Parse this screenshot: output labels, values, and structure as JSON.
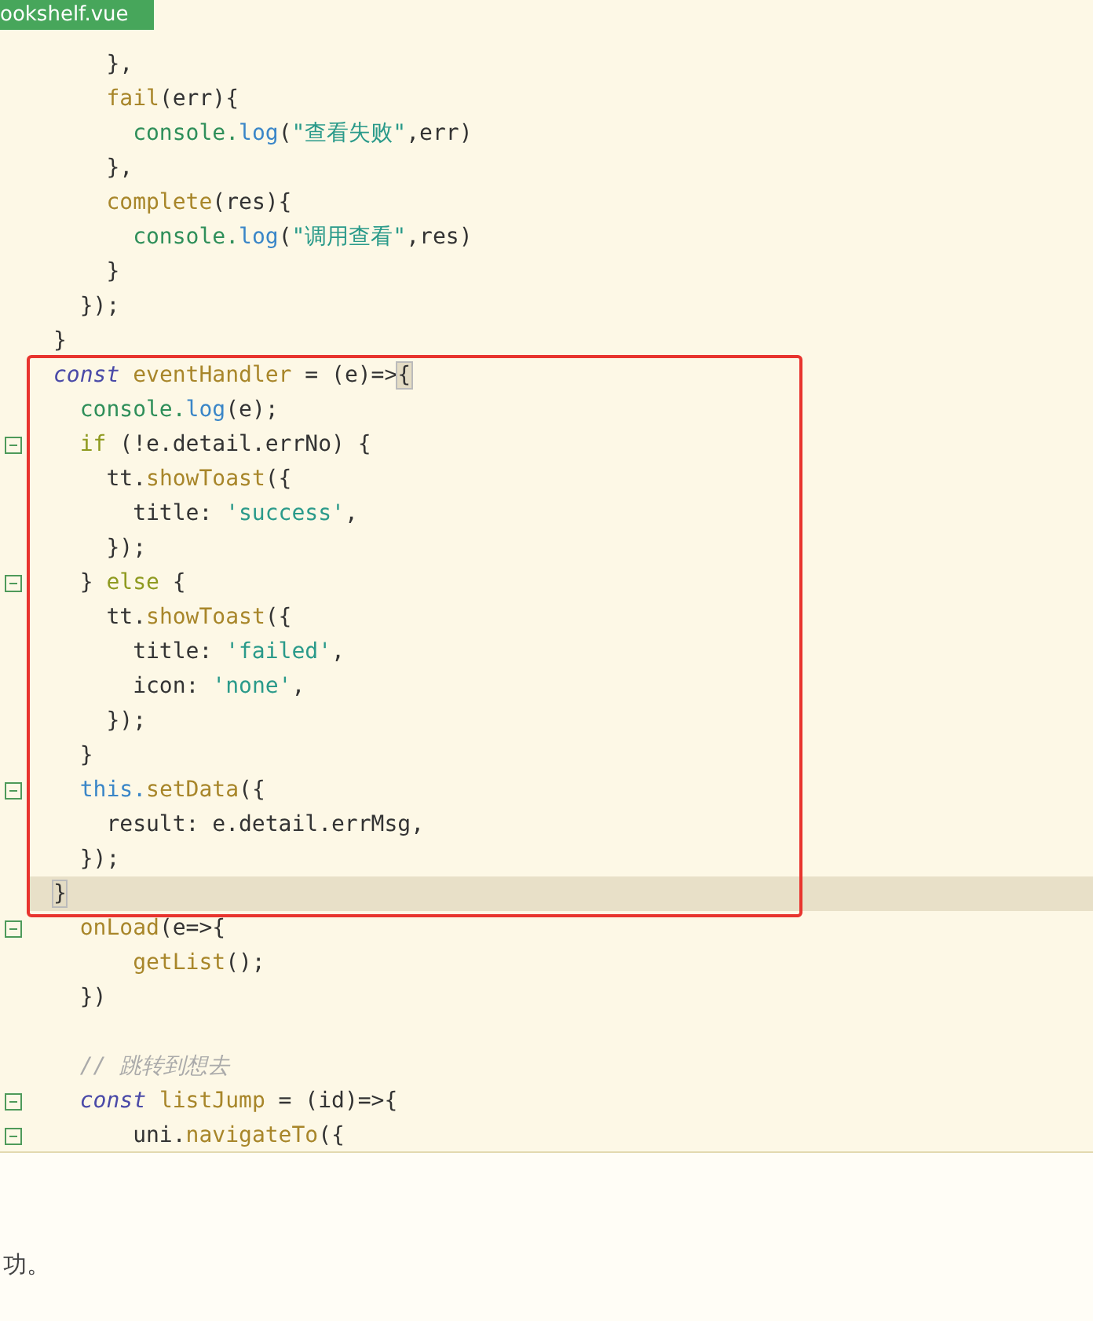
{
  "tab": {
    "title": "ookshelf.vue",
    "selected": true
  },
  "editor": {
    "blocks": [
      {
        "boxed": false,
        "lines": [
          {
            "fold": false,
            "current": false,
            "tokens": [
              {
                "text": "    },",
                "kind": "plain"
              }
            ]
          },
          {
            "fold": false,
            "current": false,
            "tokens": [
              {
                "text": "    fail",
                "kind": "func"
              },
              {
                "text": "(err){",
                "kind": "plain"
              }
            ]
          },
          {
            "fold": false,
            "current": false,
            "tokens": [
              {
                "text": "      console.",
                "kind": "obj"
              },
              {
                "text": "log",
                "kind": "method"
              },
              {
                "text": "(",
                "kind": "plain"
              },
              {
                "text": "\"查看失败\"",
                "kind": "string"
              },
              {
                "text": ",err)",
                "kind": "plain"
              }
            ]
          },
          {
            "fold": false,
            "current": false,
            "tokens": [
              {
                "text": "    },",
                "kind": "plain"
              }
            ]
          },
          {
            "fold": false,
            "current": false,
            "tokens": [
              {
                "text": "    complete",
                "kind": "func"
              },
              {
                "text": "(res){",
                "kind": "plain"
              }
            ]
          },
          {
            "fold": false,
            "current": false,
            "tokens": [
              {
                "text": "      console.",
                "kind": "obj"
              },
              {
                "text": "log",
                "kind": "method"
              },
              {
                "text": "(",
                "kind": "plain"
              },
              {
                "text": "\"调用查看\"",
                "kind": "string"
              },
              {
                "text": ",res)",
                "kind": "plain"
              }
            ]
          },
          {
            "fold": false,
            "current": false,
            "tokens": [
              {
                "text": "    }",
                "kind": "plain"
              }
            ]
          },
          {
            "fold": false,
            "current": false,
            "tokens": [
              {
                "text": "  });",
                "kind": "plain"
              }
            ]
          },
          {
            "fold": false,
            "current": false,
            "tokens": [
              {
                "text": "}",
                "kind": "plain"
              }
            ]
          }
        ]
      },
      {
        "boxed": true,
        "lines": [
          {
            "fold": false,
            "current": false,
            "tokens": [
              {
                "text": "const",
                "kind": "keyword"
              },
              {
                "text": " eventHandler",
                "kind": "func"
              },
              {
                "text": " = (e)=>",
                "kind": "plain"
              },
              {
                "text": "{",
                "kind": "match"
              }
            ]
          },
          {
            "fold": false,
            "current": false,
            "tokens": [
              {
                "text": "  console.",
                "kind": "obj"
              },
              {
                "text": "log",
                "kind": "method"
              },
              {
                "text": "(e);",
                "kind": "plain"
              }
            ]
          },
          {
            "fold": true,
            "current": false,
            "tokens": [
              {
                "text": "  if",
                "kind": "control"
              },
              {
                "text": " (!e.detail.errNo) {",
                "kind": "plain"
              }
            ]
          },
          {
            "fold": false,
            "current": false,
            "tokens": [
              {
                "text": "    tt.",
                "kind": "plain"
              },
              {
                "text": "showToast",
                "kind": "func"
              },
              {
                "text": "({",
                "kind": "plain"
              }
            ]
          },
          {
            "fold": false,
            "current": false,
            "tokens": [
              {
                "text": "      title: ",
                "kind": "plain"
              },
              {
                "text": "'success'",
                "kind": "string"
              },
              {
                "text": ",",
                "kind": "plain"
              }
            ]
          },
          {
            "fold": false,
            "current": false,
            "tokens": [
              {
                "text": "    });",
                "kind": "plain"
              }
            ]
          },
          {
            "fold": true,
            "current": false,
            "tokens": [
              {
                "text": "  } ",
                "kind": "plain"
              },
              {
                "text": "else",
                "kind": "control"
              },
              {
                "text": " {",
                "kind": "plain"
              }
            ]
          },
          {
            "fold": false,
            "current": false,
            "tokens": [
              {
                "text": "    tt.",
                "kind": "plain"
              },
              {
                "text": "showToast",
                "kind": "func"
              },
              {
                "text": "({",
                "kind": "plain"
              }
            ]
          },
          {
            "fold": false,
            "current": false,
            "tokens": [
              {
                "text": "      title: ",
                "kind": "plain"
              },
              {
                "text": "'failed'",
                "kind": "string"
              },
              {
                "text": ",",
                "kind": "plain"
              }
            ]
          },
          {
            "fold": false,
            "current": false,
            "tokens": [
              {
                "text": "      icon: ",
                "kind": "plain"
              },
              {
                "text": "'none'",
                "kind": "string"
              },
              {
                "text": ",",
                "kind": "plain"
              }
            ]
          },
          {
            "fold": false,
            "current": false,
            "tokens": [
              {
                "text": "    });",
                "kind": "plain"
              }
            ]
          },
          {
            "fold": false,
            "current": false,
            "tokens": [
              {
                "text": "  }",
                "kind": "plain"
              }
            ]
          },
          {
            "fold": true,
            "current": false,
            "tokens": [
              {
                "text": "  this.",
                "kind": "method"
              },
              {
                "text": "setData",
                "kind": "func"
              },
              {
                "text": "({",
                "kind": "plain"
              }
            ]
          },
          {
            "fold": false,
            "current": false,
            "tokens": [
              {
                "text": "    result: e.detail.errMsg,",
                "kind": "plain"
              }
            ]
          },
          {
            "fold": false,
            "current": false,
            "tokens": [
              {
                "text": "  });",
                "kind": "plain"
              }
            ]
          },
          {
            "fold": false,
            "current": true,
            "tokens": [
              {
                "text": "}",
                "kind": "match"
              }
            ]
          }
        ]
      },
      {
        "boxed": false,
        "lines": [
          {
            "fold": true,
            "current": false,
            "tokens": [
              {
                "text": "  onLoad",
                "kind": "func"
              },
              {
                "text": "(e=>{",
                "kind": "plain"
              }
            ]
          },
          {
            "fold": false,
            "current": false,
            "tokens": [
              {
                "text": "      getList",
                "kind": "func"
              },
              {
                "text": "();",
                "kind": "plain"
              }
            ]
          },
          {
            "fold": false,
            "current": false,
            "tokens": [
              {
                "text": "  })",
                "kind": "plain"
              }
            ]
          },
          {
            "fold": false,
            "current": false
          },
          {
            "fold": false,
            "current": false,
            "tokens": [
              {
                "text": "  // 跳转到想去",
                "kind": "comment"
              }
            ]
          },
          {
            "fold": true,
            "current": false,
            "tokens": [
              {
                "text": "  const",
                "kind": "keyword"
              },
              {
                "text": " listJump",
                "kind": "func"
              },
              {
                "text": " = (id)=>{",
                "kind": "plain"
              }
            ]
          },
          {
            "fold": true,
            "current": false,
            "tokens": [
              {
                "text": "      uni.",
                "kind": "plain"
              },
              {
                "text": "navigateTo",
                "kind": "func"
              },
              {
                "text": "({",
                "kind": "plain"
              }
            ]
          }
        ]
      }
    ]
  },
  "below_text": "功。"
}
